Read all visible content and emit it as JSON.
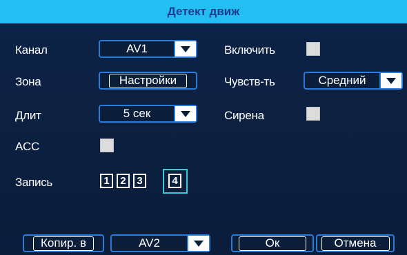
{
  "title": "Детект движ",
  "rows": {
    "channel": {
      "label": "Канал",
      "value": "AV1"
    },
    "enable": {
      "label": "Включить"
    },
    "zone": {
      "label": "Зона",
      "button": "Настройки"
    },
    "sensitivity": {
      "label": "Чувств-ть",
      "value": "Средний"
    },
    "duration": {
      "label": "Длит",
      "value": "5 сек"
    },
    "siren": {
      "label": "Сирена"
    },
    "acc": {
      "label": "ACC"
    },
    "record": {
      "label": "Запись",
      "channels": [
        "1",
        "2",
        "3",
        "4"
      ],
      "selected": "4"
    }
  },
  "footer": {
    "copy_label": "Копир. в",
    "copy_target": "AV2",
    "ok_label": "Ок",
    "cancel_label": "Отмена"
  },
  "colors": {
    "accent": "#23bff2",
    "title_text": "#1b3c8e",
    "border": "#2b7bd8",
    "background": "#0b1e3a",
    "selection": "#3fc9d6"
  },
  "icons": {
    "dropdown": "dropdown-arrow-icon",
    "checkbox": "checkbox-icon"
  }
}
